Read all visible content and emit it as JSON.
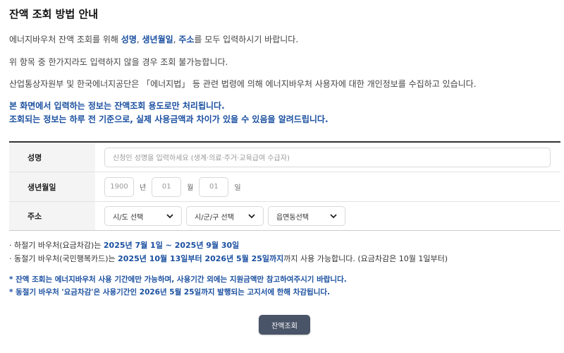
{
  "page": {
    "title": "잔액 조회 방법 안내"
  },
  "guide": {
    "line1_prefix": "에너지바우처 잔액 조회를 위해 ",
    "line1_name": "성명",
    "line1_sep1": ", ",
    "line1_birth": "생년월일",
    "line1_sep2": ", ",
    "line1_addr": "주소",
    "line1_suffix": "를 모두 입력하시기 바랍니다.",
    "line2": "위 항목 중 한가지라도 입력하지 않을 경우 조회 불가능합니다.",
    "line3": "산업통상자원부 및 한국에너지공단은 「에너지법」 등 관련 법령에 의해 에너지바우처 사용자에 대한 개인정보를 수집하고 있습니다.",
    "line4": "본 화면에서 입력하는 정보는 잔액조회 용도로만 처리됩니다.",
    "line5": "조회되는 정보는 하루 전 기준으로, 실제 사용금액과 차이가 있을 수 있음을 알려드립니다."
  },
  "form": {
    "name_label": "성명",
    "name_placeholder": "신청인 성명을 입력하세요 (생계·의료·주거·교육급여 수급자)",
    "birth_label": "생년월일",
    "birth_year_placeholder": "1900",
    "birth_year_unit": "년",
    "birth_month_placeholder": "01",
    "birth_month_unit": "월",
    "birth_day_placeholder": "01",
    "birth_day_unit": "일",
    "address_label": "주소",
    "sido_selected": "시/도 선택",
    "sigungu_selected": "시/군/구 선택",
    "eupmyeondong_selected": "읍면동선택"
  },
  "notes": {
    "summer_prefix": "· 하절기 바우처(요금차감)는 ",
    "summer_period": "2025년 7월 1일 ~ 2025년 9월 30일",
    "winter_prefix": "· 동절기 바우처(국민행복카드)는 ",
    "winter_period": "2025년 10월 13일부터 2026년 5월 25일까지",
    "winter_suffix": "까지 사용 가능합니다. (요금차감은 10월 1일부터)",
    "notice1": "* 잔액 조회는 에너지바우처 사용 기간에만 가능하며, 사용기간 외에는 지원금액만 참고하여주시기 바랍니다.",
    "notice2": "* 동절기 바우처 '요금차감'은 사용기간인 2026년 5월 25일까지 발행되는 고지서에 한해 차감됩니다."
  },
  "actions": {
    "search_label": "잔액조회"
  },
  "colors": {
    "accent": "#1a4fa0",
    "button": "#4a5468"
  }
}
